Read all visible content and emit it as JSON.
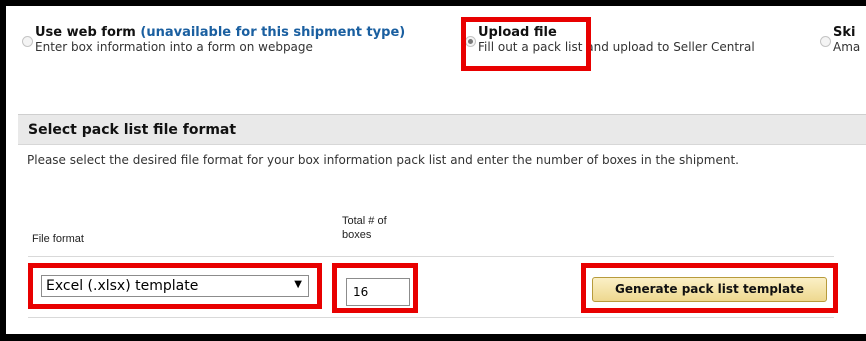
{
  "options": [
    {
      "title": "Use web form",
      "title_note": "(unavailable for this shipment type)",
      "description": "Enter box information into a form on webpage",
      "selected": false
    },
    {
      "title": "Upload file",
      "description": "Fill out a pack list and upload to Seller Central",
      "selected": true
    },
    {
      "title": "Ski",
      "description": "Ama",
      "selected": false
    }
  ],
  "section": {
    "title": "Select pack list file format",
    "instructions": "Please select the desired file format for your box information pack list and enter the number of boxes in the shipment."
  },
  "form": {
    "file_format_label": "File format",
    "total_boxes_label_line1": "Total # of",
    "total_boxes_label_line2": "boxes",
    "file_format_value": "Excel (.xlsx) template",
    "total_boxes_value": "16",
    "generate_button_label": "Generate pack list template"
  },
  "colors": {
    "highlight": "#e80000",
    "link_note": "#1a5fa0",
    "button_bg": "#f3e2a6",
    "section_header_bg": "#e9e9e9"
  }
}
